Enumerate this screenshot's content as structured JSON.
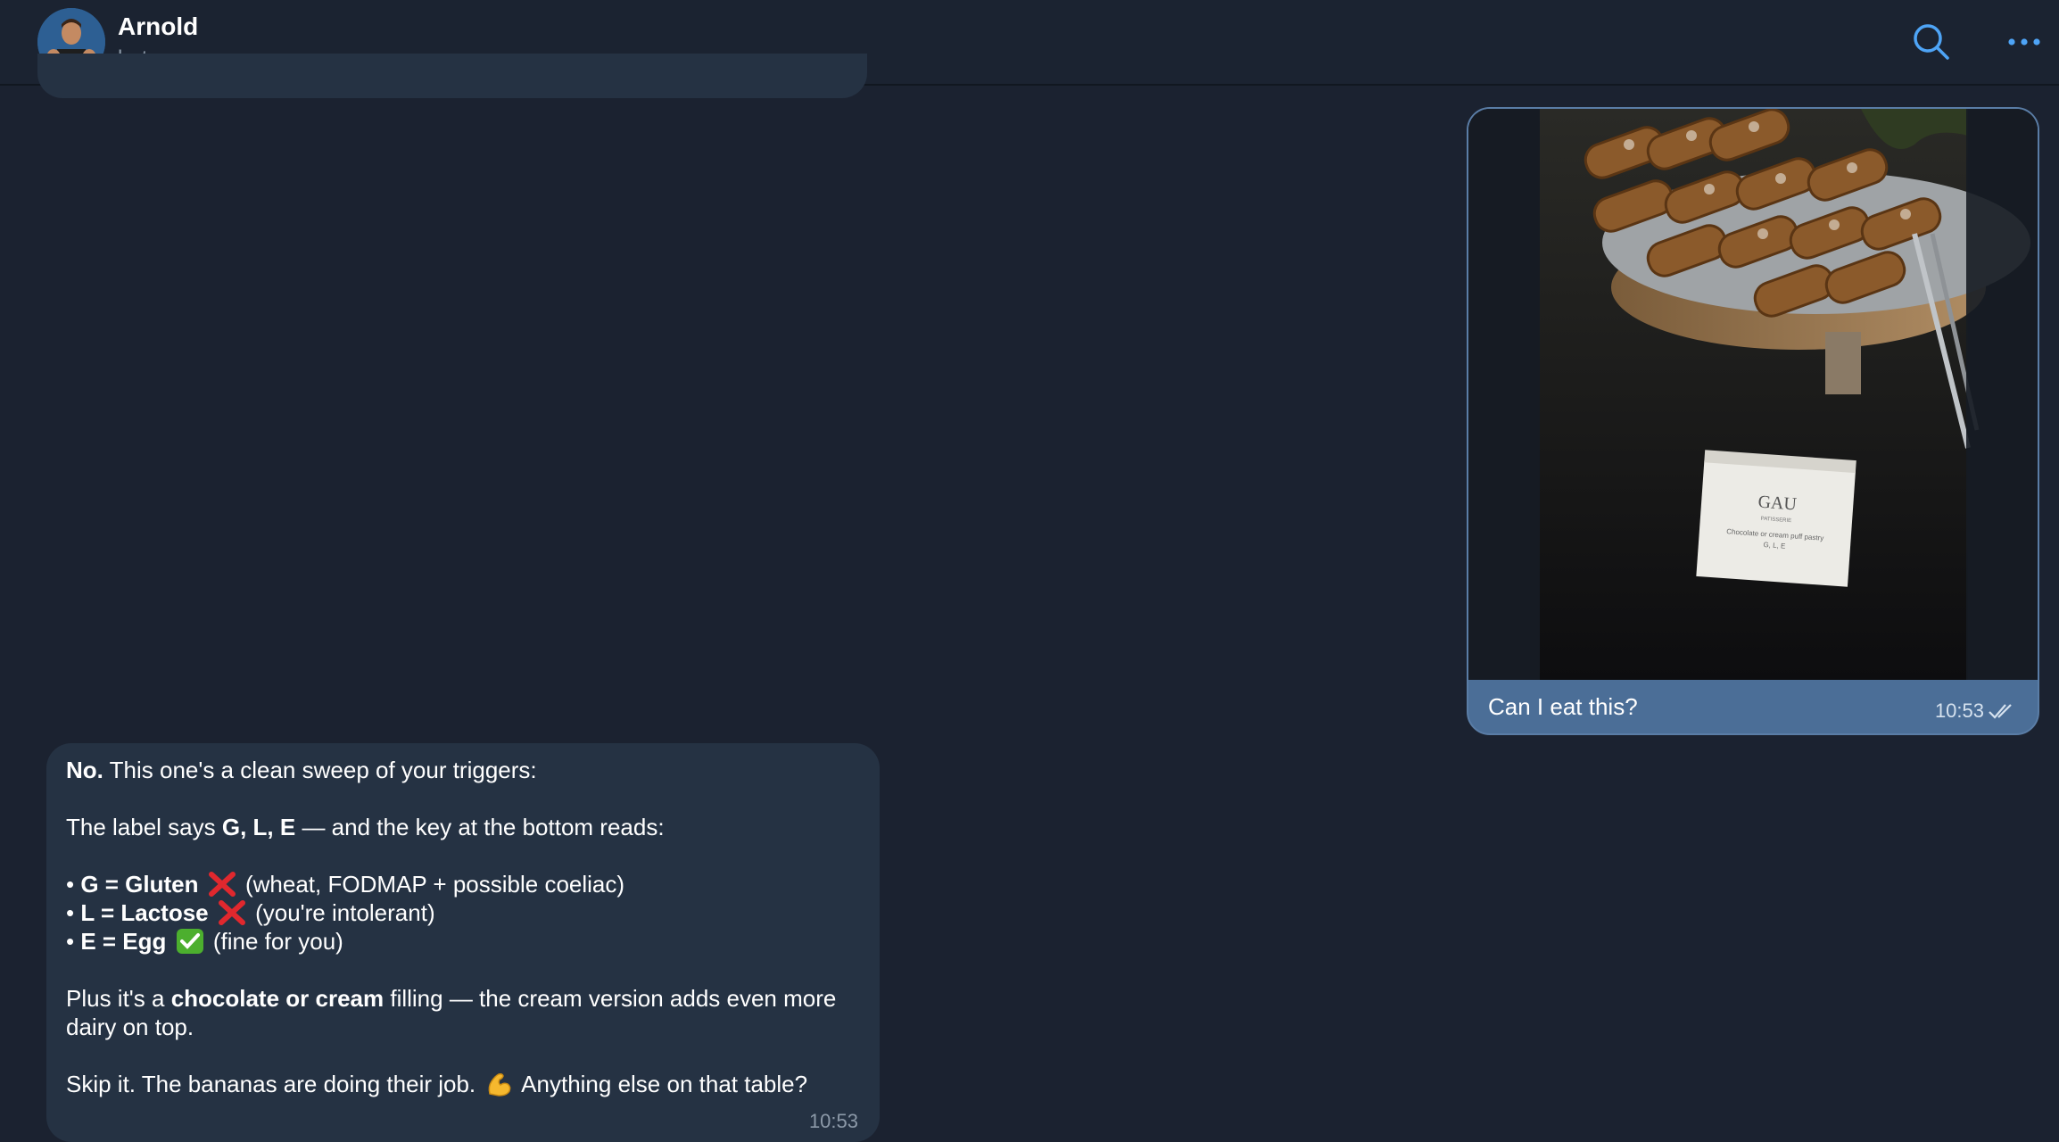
{
  "header": {
    "name": "Arnold",
    "status": "bot"
  },
  "outgoing": {
    "caption": "Can I eat this?",
    "time": "10:53",
    "photo_label": {
      "brand": "GAU",
      "sub": "PATISSERIE",
      "product": "Chocolate or cream puff pastry",
      "codes": "G, L, E"
    }
  },
  "incoming": {
    "time": "10:53",
    "line1_bold": "No.",
    "line1_rest": " This one's a clean sweep of your triggers:",
    "line2_a": "The label says ",
    "line2_bold": "G, L, E",
    "line2_b": " — and the key at the bottom reads:",
    "bullets": [
      {
        "prefix": "• ",
        "bold": "G = Gluten",
        "emoji": "cross-mark",
        "rest": " (wheat, FODMAP + possible coeliac)"
      },
      {
        "prefix": "• ",
        "bold": "L = Lactose",
        "emoji": "cross-mark",
        "rest": " (you're intolerant)"
      },
      {
        "prefix": "• ",
        "bold": "E = Egg",
        "emoji": "check-mark",
        "rest": " (fine for you)"
      }
    ],
    "para3_a": "Plus it's a ",
    "para3_bold": "chocolate or cream",
    "para3_b": " filling — the cream version adds even more dairy on top.",
    "para4_a": "Skip it. The bananas are doing their job. ",
    "para4_b": " Anything else on that table?"
  },
  "colors": {
    "background": "#1b2230",
    "outgoing_bubble": "#4b6e97",
    "incoming_bubble": "#253243",
    "accent": "#4ea4f6"
  }
}
